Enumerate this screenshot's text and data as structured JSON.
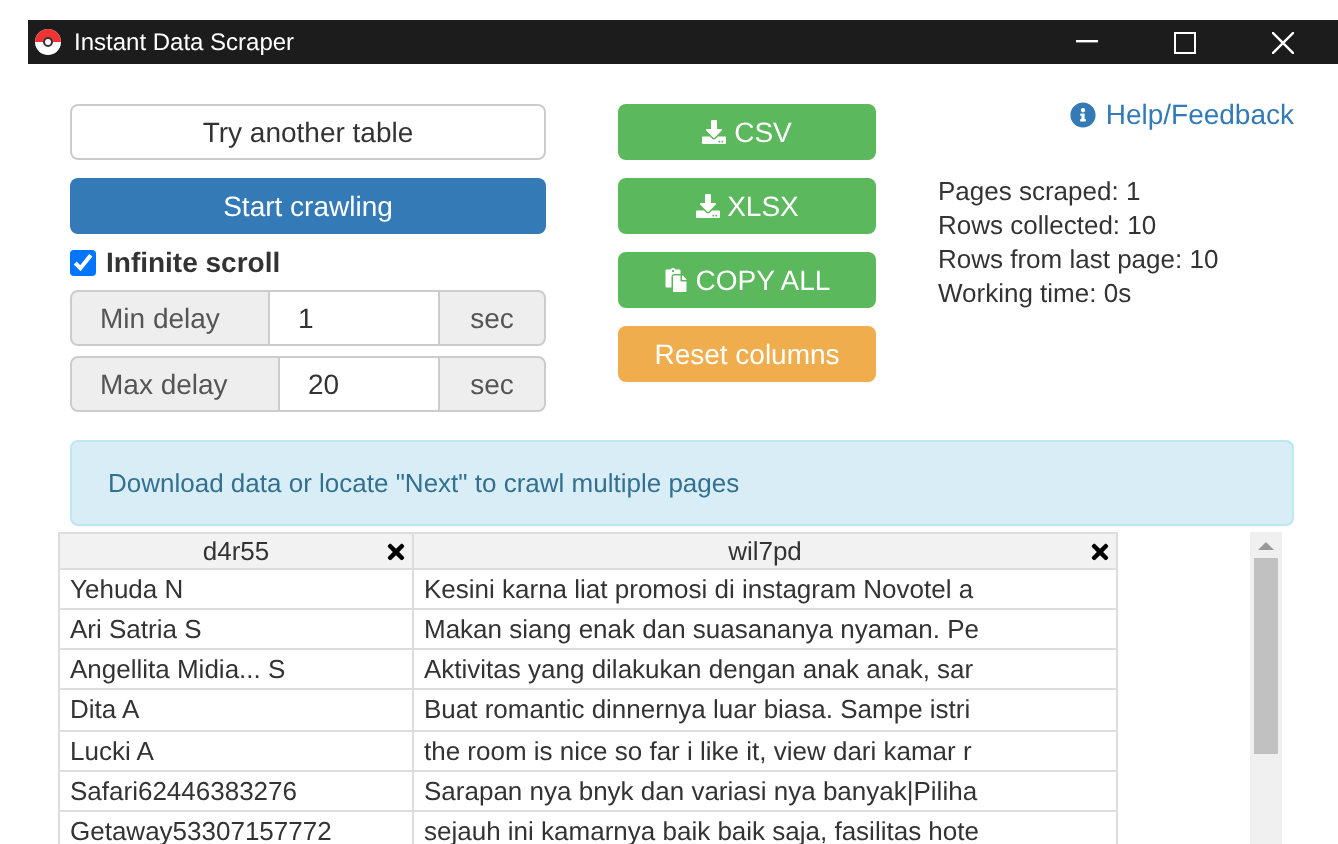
{
  "window": {
    "title": "Instant Data Scraper"
  },
  "buttons": {
    "try_another": "Try another table",
    "start": "Start crawling",
    "csv": "CSV",
    "xlsx": "XLSX",
    "copy_all": "COPY ALL",
    "reset": "Reset columns"
  },
  "infinite_scroll": {
    "label": "Infinite scroll",
    "checked": true
  },
  "delays": [
    {
      "label": "Min delay",
      "value": "1",
      "unit": "sec"
    },
    {
      "label": "Max delay",
      "value": "20",
      "unit": "sec"
    }
  ],
  "help_link": "Help/Feedback",
  "stats": [
    "Pages scraped: 1",
    "Rows collected: 10",
    "Rows from last page: 10",
    "Working time: 0s"
  ],
  "info_banner": "Download data or locate \"Next\" to crawl multiple pages",
  "table": {
    "columns": [
      "d4r55",
      "wil7pd"
    ],
    "rows": [
      [
        "Yehuda N",
        "Kesini karna liat promosi di instagram Novotel a"
      ],
      [
        "Ari Satria S",
        "Makan siang enak dan suasananya nyaman. Pe"
      ],
      [
        "Angellita Midia... S",
        "Aktivitas yang dilakukan dengan anak anak, sar"
      ],
      [
        "Dita A",
        "Buat romantic dinnernya luar biasa. Sampe istri"
      ],
      [
        "Lucki A",
        "the room is nice so far i like it, view dari kamar r"
      ],
      [
        "Safari62446383276",
        "Sarapan nya bnyk dan variasi nya banyak|Piliha"
      ],
      [
        "Getaway53307157772",
        "sejauh ini kamarnya baik baik saja, fasilitas hote"
      ]
    ]
  }
}
